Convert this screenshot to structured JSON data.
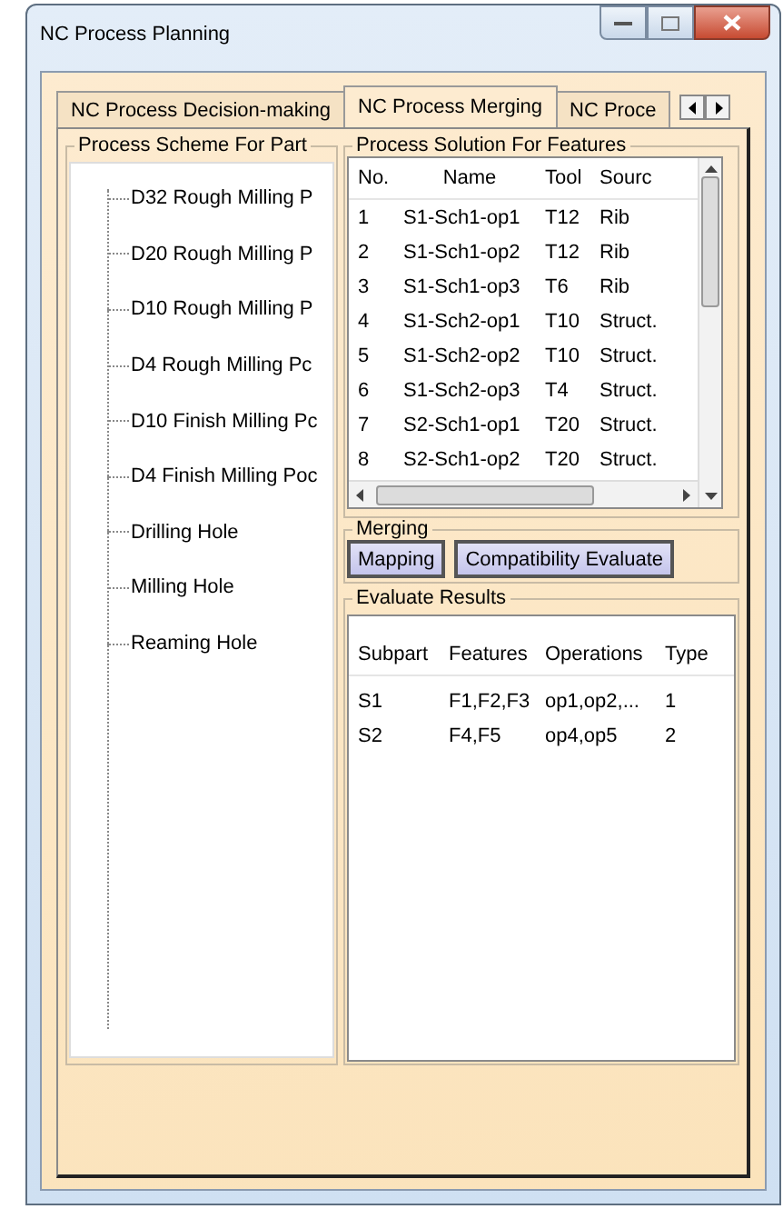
{
  "window": {
    "title": "NC Process Planning"
  },
  "tabs": [
    {
      "label": "NC Process Decision-making",
      "selected": false
    },
    {
      "label": "NC Process Merging",
      "selected": true
    },
    {
      "label": "NC Proce",
      "selected": false
    }
  ],
  "scheme": {
    "title": "Process Scheme For Part",
    "items": [
      "D32 Rough Milling P",
      "D20 Rough Milling P",
      "D10 Rough Milling P",
      "D4 Rough Milling Pc",
      "D10 Finish Milling Pc",
      "D4 Finish Milling Poc",
      "Drilling Hole",
      "Milling Hole",
      "Reaming Hole"
    ]
  },
  "solution": {
    "title": "Process Solution For Features",
    "columns": [
      "No.",
      "Name",
      "Tool",
      "Sourc"
    ],
    "rows": [
      [
        "1",
        "S1-Sch1-op1",
        "T12",
        "Rib"
      ],
      [
        "2",
        "S1-Sch1-op2",
        "T12",
        "Rib"
      ],
      [
        "3",
        "S1-Sch1-op3",
        "T6",
        "Rib"
      ],
      [
        "4",
        "S1-Sch2-op1",
        "T10",
        "Struct."
      ],
      [
        "5",
        "S1-Sch2-op2",
        "T10",
        "Struct."
      ],
      [
        "6",
        "S1-Sch2-op3",
        "T4",
        "Struct."
      ],
      [
        "7",
        "S2-Sch1-op1",
        "T20",
        "Struct."
      ],
      [
        "8",
        "S2-Sch1-op2",
        "T20",
        "Struct."
      ]
    ]
  },
  "merging": {
    "title": "Merging",
    "buttons": [
      "Mapping",
      "Compatibility Evaluate"
    ]
  },
  "results": {
    "title": "Evaluate Results",
    "columns": [
      "Subpart",
      "Features",
      "Operations",
      "Type"
    ],
    "rows": [
      [
        "S1",
        "F1,F2,F3",
        "op1,op2,...",
        "1"
      ],
      [
        "S2",
        "F4,F5",
        "op4,op5",
        "2"
      ]
    ]
  }
}
